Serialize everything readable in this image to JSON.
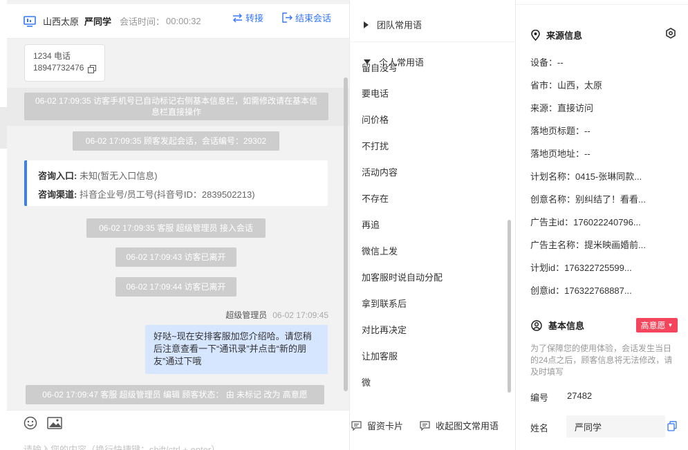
{
  "chat": {
    "header": {
      "location": "山西太原",
      "visitor_name": "严同学",
      "session_time_label": "会话时间：",
      "session_time": "00:00:32",
      "transfer_label": "转接",
      "end_label": "结束会话"
    },
    "card": {
      "line1": "1234 电话",
      "line2": "18947732476"
    },
    "system_messages": [
      "06-02 17:09:35 访客手机号已自动标记右侧基本信息栏，如需修改请在基本信息栏直接操作",
      "06-02 17:09:35 顾客发起会话，会话编号：29302",
      "06-02 17:09:35 客服 超级管理员 接入会话",
      "06-02 17:09:43 访客已离开",
      "06-02 17:09:44 访客已离开",
      "06-02 17:09:47 客服 超级管理员 编辑 顾客状态： 由 未标记 改为 高意愿"
    ],
    "info_card": {
      "entry_label": "咨询入口:",
      "entry_value": "未知(暂无入口信息)",
      "channel_label": "咨询渠道:",
      "channel_value": "抖音企业号/员工号(抖音号ID：2839502213)"
    },
    "agent_message": {
      "sender": "超级管理员",
      "time": "06-02 17:09:45",
      "text": "好哒~现在安排客服加您介绍哈。请您稍后注意查看一下“通讯录”并点击“新的朋友”通过下哦"
    },
    "input_placeholder": "请输入您的内容（换行快捷键：shift/ctrl + enter）"
  },
  "phrases": {
    "team_group": "团队常用语",
    "personal_group": "个人常用语",
    "ghost_item": "留自没写",
    "items": [
      "要电话",
      "问价格",
      "不打扰",
      "活动内容",
      "不存在",
      "再追",
      "微信上发",
      "加客服时说自动分配",
      "拿到联系后",
      "对比再决定",
      "让加客服",
      "微"
    ],
    "footer": {
      "card_button": "留资卡片",
      "collapse_button": "收起图文常用语"
    }
  },
  "info": {
    "source": {
      "title": "来源信息",
      "rows": [
        "设备：--",
        "省市：山西，太原",
        "来源：直接访问",
        "落地页标题：--",
        "落地页地址：--",
        "计划名称：0415-张琳同款...",
        "创意名称：别纠结了！看看...",
        "广告主id：176022240796...",
        "广告主名称：提米映画婚前...",
        "计划id：176322725599...",
        "创意id：176322768887..."
      ]
    },
    "basic": {
      "title": "基本信息",
      "intent_badge": "高意愿",
      "notice": "为了保障您的使用体验，会话发生当日的24点之后，顾客信息将无法修改，请及时填写",
      "id_label": "编号",
      "id_value": "27482",
      "name_label": "姓名",
      "name_value": "严同学"
    }
  }
}
